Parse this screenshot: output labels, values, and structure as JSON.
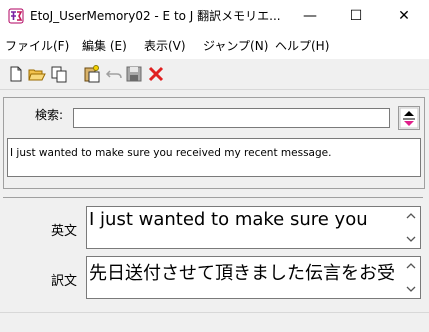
{
  "window": {
    "title": "EtoJ_UserMemory02 - E to J 翻訳メモリエ...",
    "minimize_glyph": "—",
    "maximize_glyph": "☐",
    "close_glyph": "✕"
  },
  "menu": [
    {
      "label": "ファイル(F)"
    },
    {
      "label": "編集 (E)"
    },
    {
      "label": "表示(V)"
    },
    {
      "label": "ジャンプ(N)"
    },
    {
      "label": "ヘルプ(H)"
    }
  ],
  "toolbar": {
    "icons": [
      "new-file-icon",
      "open-folder-icon",
      "copy-icon",
      "paste-icon",
      "undo-icon",
      "save-icon",
      "delete-icon"
    ],
    "delete_color": "#e02020"
  },
  "search": {
    "label": "検索:",
    "value": "",
    "placeholder": ""
  },
  "results": {
    "items": [
      "I just wanted to make sure you received my recent message."
    ]
  },
  "source": {
    "label": "英文",
    "value": "I just wanted to make sure you"
  },
  "translation": {
    "label": "訳文",
    "value": "先日送付させて頂きました伝言をお受"
  }
}
